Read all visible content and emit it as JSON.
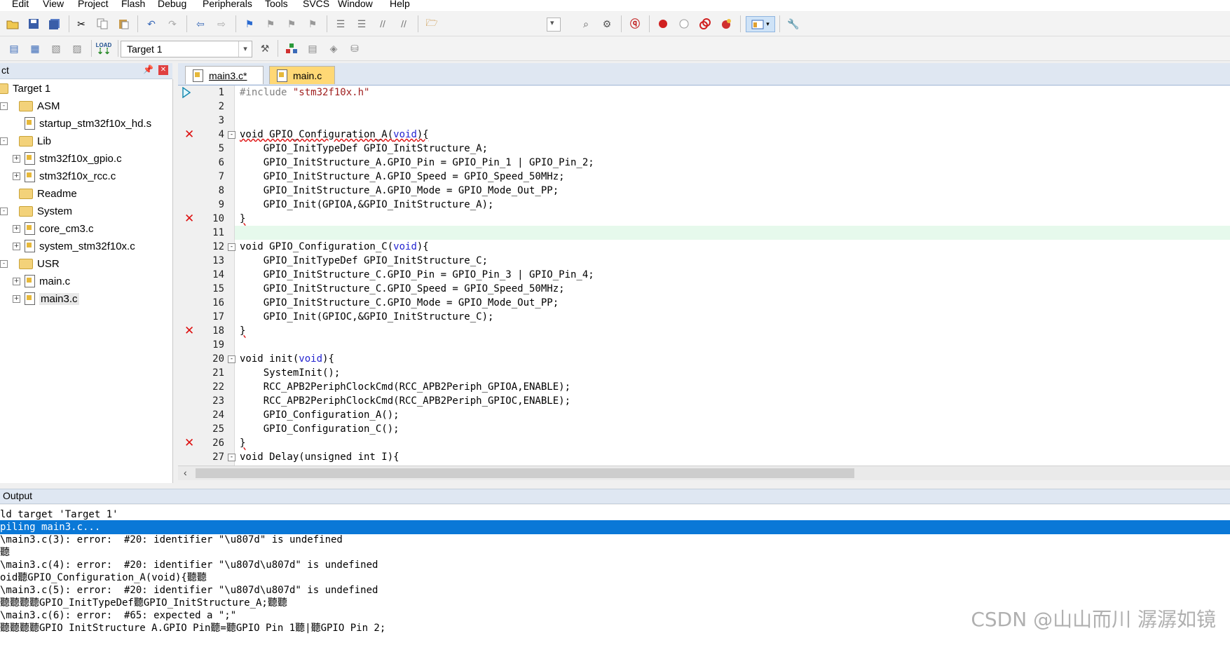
{
  "menu": [
    "Edit",
    "View",
    "Project",
    "Flash",
    "Debug",
    "Peripherals",
    "Tools",
    "SVCS",
    "Window",
    "Help"
  ],
  "toolbar": {
    "target_combo": "Target 1",
    "icons": [
      "open-folder-icon",
      "save-icon",
      "save-all-icon",
      "cut-icon",
      "copy-icon",
      "paste-icon",
      "undo-icon",
      "redo-icon",
      "nav-back-icon",
      "nav-forward-icon",
      "bookmark-icon",
      "prev-bookmark-icon",
      "next-bookmark-icon",
      "clear-bookmarks-icon",
      "indent-icon",
      "unindent-icon",
      "comment-icon",
      "uncomment-icon",
      "find-in-files-icon"
    ],
    "icons_right": [
      "find-icon",
      "incremental-find-icon",
      "debug-session-icon",
      "breakpoint-icon",
      "disable-breakpoint-icon",
      "kill-breakpoints-icon",
      "kill-all-icon",
      "window-layout-icon",
      "configure-icon"
    ],
    "build_icons": [
      "translate-icon",
      "build-icon",
      "rebuild-icon",
      "batch-build-icon",
      "download-icon"
    ],
    "options_icons": [
      "target-options-icon",
      "manage-components-icon",
      "select-packs-icon",
      "pack-installer-icon",
      "multi-project-icon"
    ],
    "build_label": "LOAD"
  },
  "project_panel": {
    "title": "ct",
    "pin": "✕",
    "tree": [
      {
        "label": "Target 1",
        "type": "target",
        "indent": 0,
        "expander": "-"
      },
      {
        "label": "ASM",
        "type": "group",
        "indent": 1,
        "expander": "-"
      },
      {
        "label": "startup_stm32f10x_hd.s",
        "type": "file",
        "indent": 2,
        "expander": ""
      },
      {
        "label": "Lib",
        "type": "group",
        "indent": 1,
        "expander": "-"
      },
      {
        "label": "stm32f10x_gpio.c",
        "type": "file",
        "indent": 2,
        "expander": "+"
      },
      {
        "label": "stm32f10x_rcc.c",
        "type": "file",
        "indent": 2,
        "expander": "+"
      },
      {
        "label": "Readme",
        "type": "group",
        "indent": 1,
        "expander": ""
      },
      {
        "label": "System",
        "type": "group",
        "indent": 1,
        "expander": "-"
      },
      {
        "label": "core_cm3.c",
        "type": "file",
        "indent": 2,
        "expander": "+"
      },
      {
        "label": "system_stm32f10x.c",
        "type": "file",
        "indent": 2,
        "expander": "+"
      },
      {
        "label": "USR",
        "type": "group",
        "indent": 1,
        "expander": "-"
      },
      {
        "label": "main.c",
        "type": "file",
        "indent": 2,
        "expander": "+"
      },
      {
        "label": "main3.c",
        "type": "file",
        "indent": 2,
        "expander": "+"
      }
    ]
  },
  "tabs": [
    {
      "label": "main3.c*",
      "active": true
    },
    {
      "label": "main.c",
      "active": false
    }
  ],
  "editor": {
    "lines": [
      {
        "n": "1",
        "code": "#include \"stm32f10x.h\"",
        "err": false,
        "fold": ""
      },
      {
        "n": "2",
        "code": "",
        "err": false,
        "fold": ""
      },
      {
        "n": "3",
        "code": "",
        "err": false,
        "fold": ""
      },
      {
        "n": "4",
        "code": "void GPIO_Configuration_A(void){",
        "err": true,
        "fold": "-"
      },
      {
        "n": "5",
        "code": "    GPIO_InitTypeDef GPIO_InitStructure_A;",
        "err": false,
        "fold": ""
      },
      {
        "n": "6",
        "code": "    GPIO_InitStructure_A.GPIO_Pin = GPIO_Pin_1 | GPIO_Pin_2;",
        "err": false,
        "fold": ""
      },
      {
        "n": "7",
        "code": "    GPIO_InitStructure_A.GPIO_Speed = GPIO_Speed_50MHz;",
        "err": false,
        "fold": ""
      },
      {
        "n": "8",
        "code": "    GPIO_InitStructure_A.GPIO_Mode = GPIO_Mode_Out_PP;",
        "err": false,
        "fold": ""
      },
      {
        "n": "9",
        "code": "    GPIO_Init(GPIOA,&GPIO_InitStructure_A);",
        "err": false,
        "fold": ""
      },
      {
        "n": "10",
        "code": "}",
        "err": true,
        "fold": ""
      },
      {
        "n": "11",
        "code": "",
        "err": false,
        "fold": "",
        "current": true
      },
      {
        "n": "12",
        "code": "void GPIO_Configuration_C(void){",
        "err": false,
        "fold": "-"
      },
      {
        "n": "13",
        "code": "    GPIO_InitTypeDef GPIO_InitStructure_C;",
        "err": false,
        "fold": ""
      },
      {
        "n": "14",
        "code": "    GPIO_InitStructure_C.GPIO_Pin = GPIO_Pin_3 | GPIO_Pin_4;",
        "err": false,
        "fold": ""
      },
      {
        "n": "15",
        "code": "    GPIO_InitStructure_C.GPIO_Speed = GPIO_Speed_50MHz;",
        "err": false,
        "fold": ""
      },
      {
        "n": "16",
        "code": "    GPIO_InitStructure_C.GPIO_Mode = GPIO_Mode_Out_PP;",
        "err": false,
        "fold": ""
      },
      {
        "n": "17",
        "code": "    GPIO_Init(GPIOC,&GPIO_InitStructure_C);",
        "err": false,
        "fold": ""
      },
      {
        "n": "18",
        "code": "}",
        "err": true,
        "fold": ""
      },
      {
        "n": "19",
        "code": "",
        "err": false,
        "fold": ""
      },
      {
        "n": "20",
        "code": "void init(void){",
        "err": false,
        "fold": "-"
      },
      {
        "n": "21",
        "code": "    SystemInit();",
        "err": false,
        "fold": ""
      },
      {
        "n": "22",
        "code": "    RCC_APB2PeriphClockCmd(RCC_APB2Periph_GPIOA,ENABLE);",
        "err": false,
        "fold": ""
      },
      {
        "n": "23",
        "code": "    RCC_APB2PeriphClockCmd(RCC_APB2Periph_GPIOC,ENABLE);",
        "err": false,
        "fold": ""
      },
      {
        "n": "24",
        "code": "    GPIO_Configuration_A();",
        "err": false,
        "fold": ""
      },
      {
        "n": "25",
        "code": "    GPIO_Configuration_C();",
        "err": false,
        "fold": ""
      },
      {
        "n": "26",
        "code": "}",
        "err": true,
        "fold": ""
      },
      {
        "n": "27",
        "code": "void Delay(unsigned int I){",
        "err": false,
        "fold": "-"
      }
    ]
  },
  "output": {
    "title": "Output",
    "lines": [
      {
        "text": "ld target 'Target 1'",
        "selected": false
      },
      {
        "text": "piling main3.c...",
        "selected": true
      },
      {
        "text": "\\main3.c(3): error:  #20: identifier \"\\u807d\" is undefined",
        "selected": false
      },
      {
        "text": "聽",
        "selected": false
      },
      {
        "text": "\\main3.c(4): error:  #20: identifier \"\\u807d\\u807d\" is undefined",
        "selected": false
      },
      {
        "text": "oid聽GPIO_Configuration_A(void){聽聽",
        "selected": false
      },
      {
        "text": "\\main3.c(5): error:  #20: identifier \"\\u807d\\u807d\" is undefined",
        "selected": false
      },
      {
        "text": "聽聽聽聽GPIO_InitTypeDef聽GPIO_InitStructure_A;聽聽",
        "selected": false
      },
      {
        "text": "\\main3.c(6): error:  #65: expected a \";\"",
        "selected": false
      },
      {
        "text": "聽聽聽聽GPIO InitStructure A.GPIO Pin聽=聽GPIO Pin 1聽|聽GPIO Pin 2;",
        "selected": false
      }
    ]
  },
  "watermark": "CSDN @山山而川 潺潺如镜",
  "colors": {
    "selection": "#0a78d7",
    "current_line": "#e6f9ec",
    "error": "#dd1111"
  }
}
